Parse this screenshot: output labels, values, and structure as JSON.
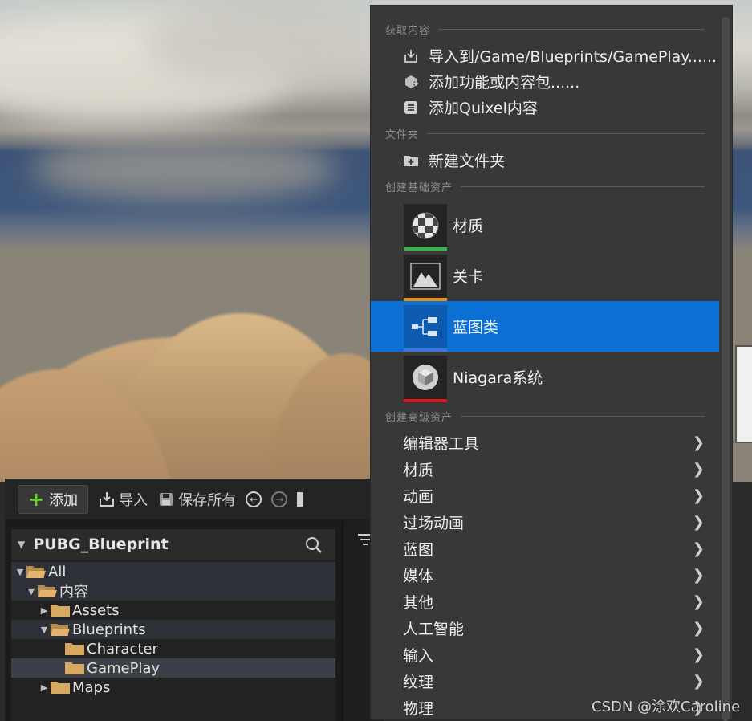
{
  "browser": {
    "toolbar": {
      "add_label": "添加",
      "import_label": "导入",
      "save_all_label": "保存所有"
    },
    "tree": {
      "root_label": "PUBG_Blueprint",
      "items": [
        {
          "label": "All"
        },
        {
          "label": "内容"
        },
        {
          "label": "Assets"
        },
        {
          "label": "Blueprints"
        },
        {
          "label": "Character"
        },
        {
          "label": "GamePlay"
        },
        {
          "label": "Maps"
        }
      ]
    }
  },
  "menu": {
    "sections": {
      "get_content": "获取内容",
      "folder": "文件夹",
      "basic_assets": "创建基础资产",
      "advanced_assets": "创建高级资产"
    },
    "get_content_items": [
      {
        "label": "导入到/Game/Blueprints/GamePlay......",
        "icon": "import-icon"
      },
      {
        "label": "添加功能或内容包......",
        "icon": "feature-pack-icon"
      },
      {
        "label": "添加Quixel内容",
        "icon": "quixel-icon"
      }
    ],
    "folder_items": [
      {
        "label": "新建文件夹",
        "icon": "new-folder-icon"
      }
    ],
    "basic_assets": [
      {
        "label": "材质",
        "color": "#3cb34a",
        "icon": "material-icon"
      },
      {
        "label": "关卡",
        "color": "#f08d0a",
        "icon": "level-icon"
      },
      {
        "label": "蓝图类",
        "color": "#3a78d8",
        "icon": "blueprint-class-icon"
      },
      {
        "label": "Niagara系统",
        "color": "#e0161c",
        "icon": "niagara-icon"
      }
    ],
    "advanced_assets": [
      {
        "label": "编辑器工具"
      },
      {
        "label": "材质"
      },
      {
        "label": "动画"
      },
      {
        "label": "过场动画"
      },
      {
        "label": "蓝图"
      },
      {
        "label": "媒体"
      },
      {
        "label": "其他"
      },
      {
        "label": "人工智能"
      },
      {
        "label": "输入"
      },
      {
        "label": "纹理"
      },
      {
        "label": "物理"
      }
    ]
  },
  "watermark": "CSDN @涂欢Caroline"
}
